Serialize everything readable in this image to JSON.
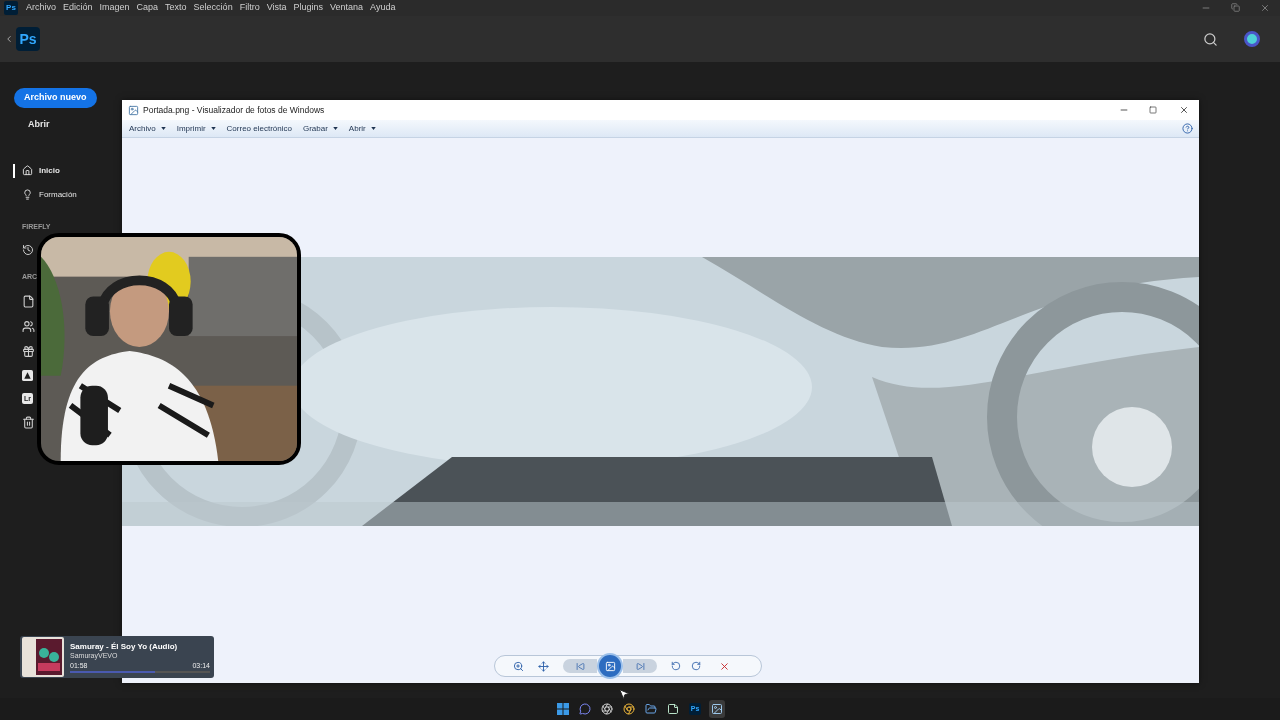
{
  "menu_bar": {
    "logo": "Ps",
    "items": [
      "Archivo",
      "Edición",
      "Imagen",
      "Capa",
      "Texto",
      "Selección",
      "Filtro",
      "Vista",
      "Plugins",
      "Ventana",
      "Ayuda"
    ]
  },
  "header": {
    "logo": "Ps"
  },
  "sidebar": {
    "primary_button": "Archivo nuevo",
    "open_link": "Abrir",
    "nav": [
      {
        "label": "Inicio",
        "selected": true
      },
      {
        "label": "Formación",
        "selected": false
      }
    ],
    "firefly_heading": "FIREFLY",
    "archive_heading": "ARC",
    "archive_items": [
      {
        "kind": "file"
      },
      {
        "kind": "people"
      },
      {
        "kind": "gift"
      },
      {
        "kind": "express"
      },
      {
        "kind": "badge",
        "badge": "Lr"
      },
      {
        "kind": "trash"
      }
    ]
  },
  "viewer": {
    "title": "Portada.png - Visualizador de fotos de Windows",
    "menu": [
      {
        "label": "Archivo",
        "dropdown": true
      },
      {
        "label": "Imprimir",
        "dropdown": true
      },
      {
        "label": "Correo electrónico",
        "dropdown": false
      },
      {
        "label": "Grabar",
        "dropdown": true
      },
      {
        "label": "Abrir",
        "dropdown": true
      }
    ]
  },
  "player": {
    "title": "Samuray - Él Soy Yo (Audio)",
    "channel": "SamurayVEVO",
    "elapsed": "01:58",
    "duration": "03:14",
    "level": 0.61
  },
  "taskbar": {
    "apps": [
      {
        "kind": "windows",
        "selected": false
      },
      {
        "kind": "chat",
        "selected": false
      },
      {
        "kind": "recorder",
        "selected": false
      },
      {
        "kind": "browser",
        "selected": false
      },
      {
        "kind": "files",
        "selected": false
      },
      {
        "kind": "notes",
        "selected": false
      },
      {
        "kind": "photoshop",
        "label": "Ps",
        "selected": false
      },
      {
        "kind": "photos",
        "selected": true
      }
    ]
  }
}
